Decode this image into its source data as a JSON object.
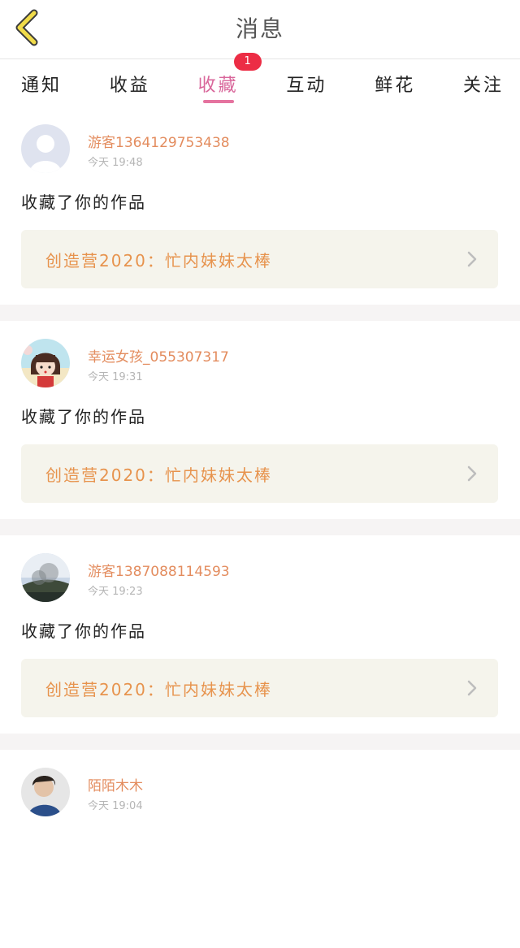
{
  "header": {
    "title": "消息"
  },
  "tabs": [
    {
      "label": "通知"
    },
    {
      "label": "收益"
    },
    {
      "label": "收藏",
      "badge": "1",
      "active": true
    },
    {
      "label": "互动"
    },
    {
      "label": "鲜花"
    },
    {
      "label": "关注"
    }
  ],
  "messages": [
    {
      "name": "游客1364129753438",
      "time": "今天 19:48",
      "action": "收藏了你的作品",
      "work": "创造营2020：忙内妹妹太棒"
    },
    {
      "name": "幸运女孩_055307317",
      "time": "今天 19:31",
      "action": "收藏了你的作品",
      "work": "创造营2020：忙内妹妹太棒"
    },
    {
      "name": "游客1387088114593",
      "time": "今天 19:23",
      "action": "收藏了你的作品",
      "work": "创造营2020：忙内妹妹太棒"
    },
    {
      "name": "陌陌木木",
      "time": "今天 19:04"
    }
  ],
  "colors": {
    "accent": "#e5739f",
    "name": "#e38c5e",
    "card_bg": "#f5f4ec",
    "card_text": "#e7934d",
    "back_icon": "#f1dc4a"
  }
}
